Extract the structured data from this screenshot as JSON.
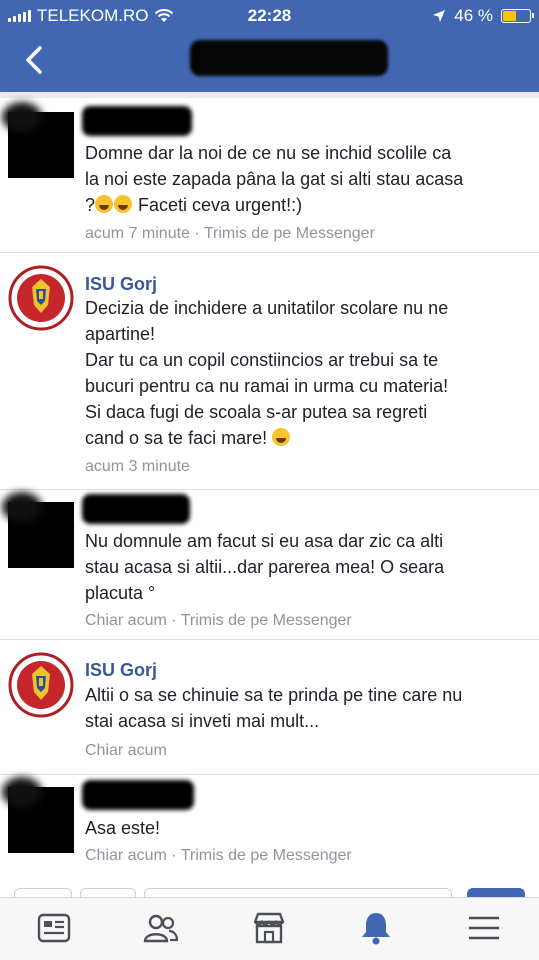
{
  "status_bar": {
    "carrier": "TELEKOM.RO",
    "time": "22:28",
    "battery_label": "46 %",
    "battery_level": 0.46
  },
  "nav": {
    "back_icon": "chevron-left-icon"
  },
  "comments": [
    {
      "author": "",
      "text_line1": "Domne dar la noi de ce nu se inchid scolile ca",
      "text_line2": "la noi este zapada pâna la gat si alti stau acasa",
      "text_line3": "?",
      "text_line3_after": " Faceti ceva urgent!:)",
      "meta": "acum 7 minute · Trimis de pe Messenger"
    },
    {
      "author": "ISU Gorj",
      "text_line1": "Decizia de inchidere a unitatilor scolare nu ne",
      "text_line2": "apartine!",
      "text_line3": "Dar tu ca un copil constiincios ar trebui sa te",
      "text_line4": "bucuri pentru ca nu ramai in urma cu materia!",
      "text_line5": "Si daca fugi de scoala s-ar putea sa regreti",
      "text_line6": "cand o sa te faci mare!",
      "meta": "acum 3 minute"
    },
    {
      "author": "",
      "text_line1": "Nu domnule am facut si eu asa dar zic ca alti",
      "text_line2": "stau acasa si altii...dar parerea mea! O seara",
      "text_line3": "placuta °",
      "meta": "Chiar acum · Trimis de pe Messenger"
    },
    {
      "author": "ISU Gorj",
      "text_line1": "Altii o sa se chinuie sa te prinda pe tine care nu",
      "text_line2": "stai acasa si inveti mai mult...",
      "meta": "Chiar acum"
    },
    {
      "author": "",
      "text_line1": "Asa este!",
      "meta": "Chiar acum · Trimis de pe Messenger"
    }
  ],
  "tabbar": {
    "tabs": [
      "news-feed-icon",
      "friends-icon",
      "marketplace-icon",
      "notifications-icon",
      "menu-icon"
    ],
    "active": "notifications-icon",
    "active_color": "#4267b2",
    "inactive_color": "#4b4f56"
  }
}
